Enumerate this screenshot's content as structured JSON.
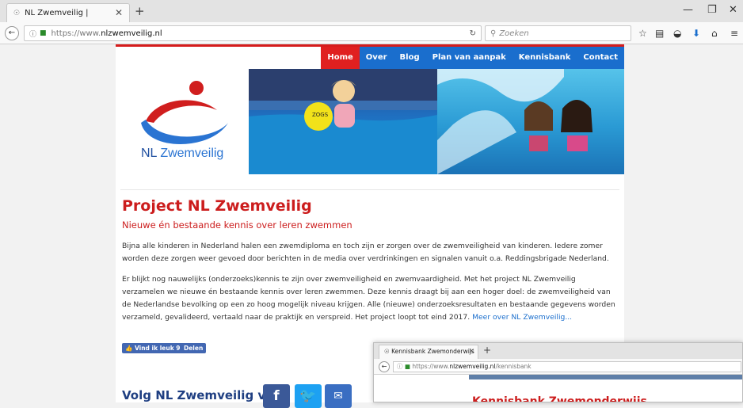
{
  "browser": {
    "tab_title": "NL Zwemveilig |",
    "url_prefix": "https://www.",
    "url_domain": "nlzwemveilig.nl",
    "search_placeholder": "Zoeken"
  },
  "site": {
    "menu": [
      "Home",
      "Over",
      "Blog",
      "Plan van aanpak",
      "Kennisbank",
      "Contact"
    ],
    "active_menu": "Home",
    "logo_nl": "NL",
    "logo_zw": "Zwemveilig",
    "title": "Project NL Zwemveilig",
    "subtitle": "Nieuwe én bestaande kennis over leren zwemmen",
    "para1": "Bijna alle kinderen in Nederland halen een zwemdiploma en toch zijn er zorgen over de zwemveiligheid van kinderen. Iedere zomer worden deze zorgen weer gevoed door berichten in de media over verdrinkingen en signalen vanuit o.a. Reddingsbrigade Nederland.",
    "para2": "Er blijkt nog nauwelijks (onderzoeks)kennis te zijn over zwemveiligheid en zwemvaardigheid. Met het project NL Zwemveilig verzamelen we nieuwe én bestaande kennis over leren zwemmen. Deze kennis draagt bij aan een hoger doel: de zwemveiligheid van de Nederlandse bevolking op een zo hoog mogelijk niveau krijgen. Alle (nieuwe) onderzoeksresultaten en bestaande gegevens worden verzameld, gevalideerd, vertaald naar de praktijk en verspreid. Het project loopt tot eind 2017.",
    "more_link": "Meer over NL Zwemveilig...",
    "like_button": "Vind ik leuk 9",
    "share_button": "Delen",
    "follow_label": "Volg NL Zwemveilig via:"
  },
  "second_window": {
    "tab_title": "Kennisbank Zwemonderwijs",
    "url_prefix": "https://www.",
    "url_domain": "nlzwemveilig.nl",
    "url_path": "/kennisbank",
    "heading": "Kennisbank Zwemonderwijs"
  },
  "colors": {
    "menu_blue": "#1a6ecd",
    "menu_red": "#e02020",
    "title_red": "#cc1d1d",
    "facebook": "#3b5998",
    "twitter": "#1da1f2"
  }
}
